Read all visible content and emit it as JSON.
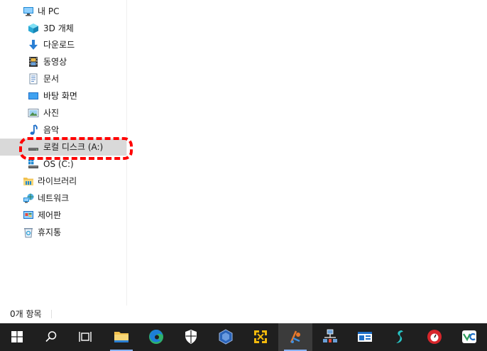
{
  "nav": {
    "items": [
      {
        "label": "내 PC",
        "icon": "this-pc-icon"
      },
      {
        "label": "3D 개체",
        "icon": "3d-objects-icon"
      },
      {
        "label": "다운로드",
        "icon": "downloads-icon"
      },
      {
        "label": "동영상",
        "icon": "videos-icon"
      },
      {
        "label": "문서",
        "icon": "documents-icon"
      },
      {
        "label": "바탕 화면",
        "icon": "desktop-icon"
      },
      {
        "label": "사진",
        "icon": "pictures-icon"
      },
      {
        "label": "음악",
        "icon": "music-icon"
      },
      {
        "label": "로컬 디스크 (A:)",
        "icon": "drive-icon",
        "selected": true
      },
      {
        "label": "OS (C:)",
        "icon": "os-drive-icon"
      },
      {
        "label": "라이브러리",
        "icon": "libraries-icon"
      },
      {
        "label": "네트워크",
        "icon": "network-icon"
      },
      {
        "label": "제어판",
        "icon": "control-panel-icon"
      },
      {
        "label": "휴지통",
        "icon": "recycle-bin-icon"
      }
    ]
  },
  "status": {
    "item_count": "0개 항목"
  },
  "colors": {
    "selection": "#d9d9d9",
    "annotation": "#ff0000",
    "taskbar": "#1f1f1f"
  },
  "taskbar": {
    "buttons": [
      {
        "icon": "windows-start-icon"
      },
      {
        "icon": "search-icon"
      },
      {
        "icon": "task-view-icon"
      },
      {
        "icon": "file-explorer-icon"
      },
      {
        "icon": "edge-icon"
      },
      {
        "icon": "security-shield-icon"
      },
      {
        "icon": "virtualbox-icon"
      },
      {
        "icon": "yellow-arrows-app-icon"
      },
      {
        "icon": "git-app-icon"
      },
      {
        "icon": "network-tool-icon"
      },
      {
        "icon": "window-app-icon"
      },
      {
        "icon": "surfshark-icon"
      },
      {
        "icon": "red-circle-app-icon"
      },
      {
        "icon": "vc-app-icon"
      }
    ]
  }
}
